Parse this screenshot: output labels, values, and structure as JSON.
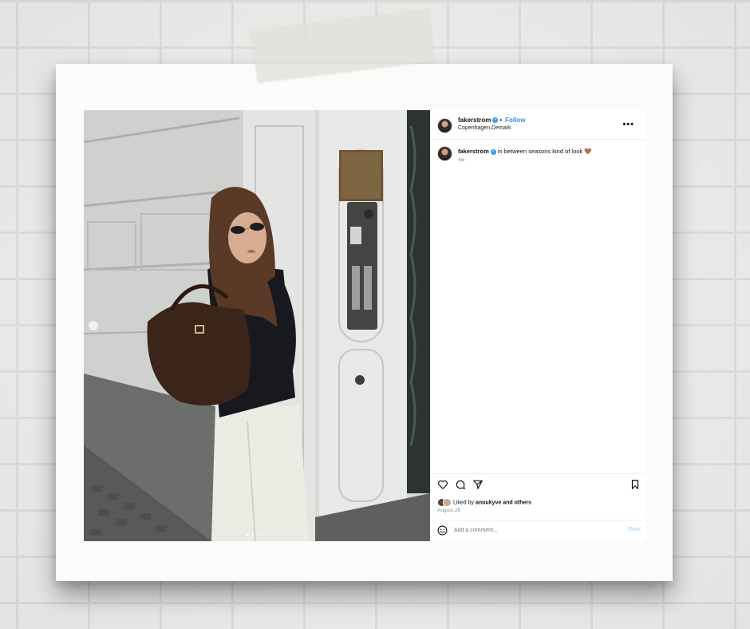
{
  "post": {
    "username": "fakerstrom",
    "verified_mark": "✓",
    "separator": "•",
    "follow_label": "Follow",
    "location": "Copenhagen,Demark",
    "more_label": "•••",
    "caption_text": "in between seasons kind of look",
    "caption_emoji": "🤎",
    "caption_time": "4w",
    "likes_prefix": "Liked by",
    "likes_user": "anoukyve",
    "likes_conjunction": "and",
    "likes_others": "others",
    "date": "August 26",
    "comment_placeholder": "Add a comment...",
    "post_label": "Post"
  },
  "icons": {
    "like": "heart-icon",
    "comment": "comment-icon",
    "share": "share-icon",
    "save": "bookmark-icon",
    "emoji": "smiley-icon",
    "more": "ellipsis-icon"
  },
  "colors": {
    "link_blue": "#2e8ef0",
    "verified_blue": "#3897f0",
    "post_button_disabled": "#b3dbff",
    "muted_text": "#8e8e8e"
  }
}
